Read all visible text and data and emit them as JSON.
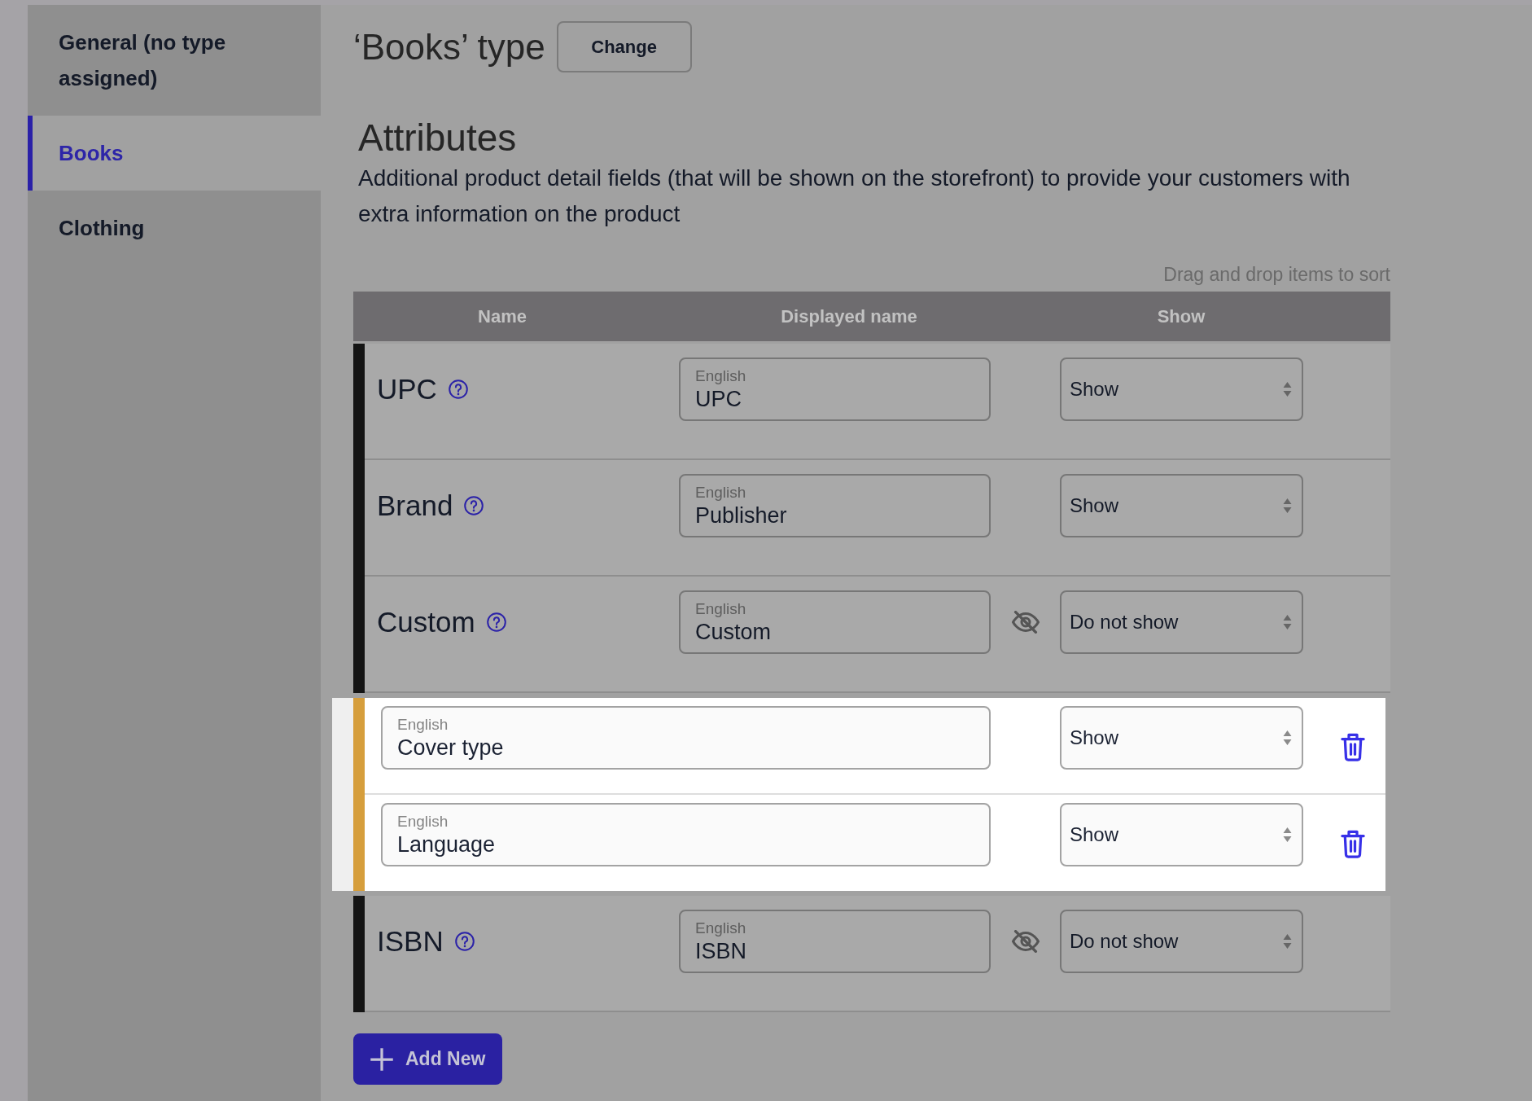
{
  "sidebar": {
    "items": [
      {
        "label": "General (no type assigned)",
        "selected": false
      },
      {
        "label": "Books",
        "selected": true
      },
      {
        "label": "Clothing",
        "selected": false
      }
    ]
  },
  "header": {
    "title": "‘Books’ type",
    "change_button": "Change"
  },
  "attributes": {
    "heading": "Attributes",
    "description": "Additional product detail fields (that will be shown on the storefront) to provide your customers with extra information on the product",
    "sort_hint": "Drag and drop items to sort"
  },
  "table": {
    "columns": [
      "Name",
      "Displayed name",
      "Show"
    ],
    "rows": [
      {
        "kind": "attribute",
        "name": "UPC",
        "language": "English",
        "displayed_name": "UPC",
        "visibility": "Show",
        "hidden": false,
        "highlighted": false
      },
      {
        "kind": "attribute",
        "name": "Brand",
        "language": "English",
        "displayed_name": "Publisher",
        "visibility": "Show",
        "hidden": false,
        "highlighted": false
      },
      {
        "kind": "attribute",
        "name": "Custom",
        "language": "English",
        "displayed_name": "Custom",
        "visibility": "Do not show",
        "hidden": true,
        "highlighted": false
      },
      {
        "kind": "custom",
        "language": "English",
        "displayed_name": "Cover type",
        "visibility": "Show",
        "hidden": false,
        "highlighted": true
      },
      {
        "kind": "custom",
        "language": "English",
        "displayed_name": "Language",
        "visibility": "Show",
        "hidden": false,
        "highlighted": true
      },
      {
        "kind": "attribute",
        "name": "ISBN",
        "language": "English",
        "displayed_name": "ISBN",
        "visibility": "Do not show",
        "hidden": true,
        "highlighted": false
      }
    ]
  },
  "add_button": {
    "label": "Add New"
  }
}
